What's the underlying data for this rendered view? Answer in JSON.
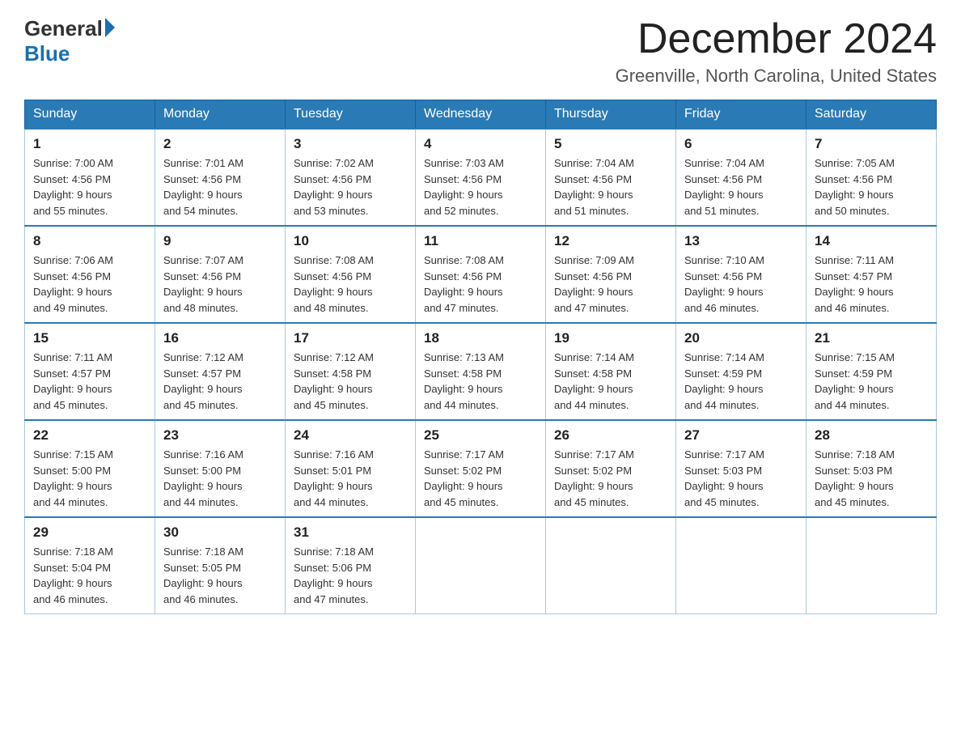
{
  "logo": {
    "general": "General",
    "blue": "Blue"
  },
  "header": {
    "month": "December 2024",
    "location": "Greenville, North Carolina, United States"
  },
  "days_of_week": [
    "Sunday",
    "Monday",
    "Tuesday",
    "Wednesday",
    "Thursday",
    "Friday",
    "Saturday"
  ],
  "weeks": [
    [
      {
        "day": "1",
        "sunrise": "7:00 AM",
        "sunset": "4:56 PM",
        "daylight": "9 hours and 55 minutes."
      },
      {
        "day": "2",
        "sunrise": "7:01 AM",
        "sunset": "4:56 PM",
        "daylight": "9 hours and 54 minutes."
      },
      {
        "day": "3",
        "sunrise": "7:02 AM",
        "sunset": "4:56 PM",
        "daylight": "9 hours and 53 minutes."
      },
      {
        "day": "4",
        "sunrise": "7:03 AM",
        "sunset": "4:56 PM",
        "daylight": "9 hours and 52 minutes."
      },
      {
        "day": "5",
        "sunrise": "7:04 AM",
        "sunset": "4:56 PM",
        "daylight": "9 hours and 51 minutes."
      },
      {
        "day": "6",
        "sunrise": "7:04 AM",
        "sunset": "4:56 PM",
        "daylight": "9 hours and 51 minutes."
      },
      {
        "day": "7",
        "sunrise": "7:05 AM",
        "sunset": "4:56 PM",
        "daylight": "9 hours and 50 minutes."
      }
    ],
    [
      {
        "day": "8",
        "sunrise": "7:06 AM",
        "sunset": "4:56 PM",
        "daylight": "9 hours and 49 minutes."
      },
      {
        "day": "9",
        "sunrise": "7:07 AM",
        "sunset": "4:56 PM",
        "daylight": "9 hours and 48 minutes."
      },
      {
        "day": "10",
        "sunrise": "7:08 AM",
        "sunset": "4:56 PM",
        "daylight": "9 hours and 48 minutes."
      },
      {
        "day": "11",
        "sunrise": "7:08 AM",
        "sunset": "4:56 PM",
        "daylight": "9 hours and 47 minutes."
      },
      {
        "day": "12",
        "sunrise": "7:09 AM",
        "sunset": "4:56 PM",
        "daylight": "9 hours and 47 minutes."
      },
      {
        "day": "13",
        "sunrise": "7:10 AM",
        "sunset": "4:56 PM",
        "daylight": "9 hours and 46 minutes."
      },
      {
        "day": "14",
        "sunrise": "7:11 AM",
        "sunset": "4:57 PM",
        "daylight": "9 hours and 46 minutes."
      }
    ],
    [
      {
        "day": "15",
        "sunrise": "7:11 AM",
        "sunset": "4:57 PM",
        "daylight": "9 hours and 45 minutes."
      },
      {
        "day": "16",
        "sunrise": "7:12 AM",
        "sunset": "4:57 PM",
        "daylight": "9 hours and 45 minutes."
      },
      {
        "day": "17",
        "sunrise": "7:12 AM",
        "sunset": "4:58 PM",
        "daylight": "9 hours and 45 minutes."
      },
      {
        "day": "18",
        "sunrise": "7:13 AM",
        "sunset": "4:58 PM",
        "daylight": "9 hours and 44 minutes."
      },
      {
        "day": "19",
        "sunrise": "7:14 AM",
        "sunset": "4:58 PM",
        "daylight": "9 hours and 44 minutes."
      },
      {
        "day": "20",
        "sunrise": "7:14 AM",
        "sunset": "4:59 PM",
        "daylight": "9 hours and 44 minutes."
      },
      {
        "day": "21",
        "sunrise": "7:15 AM",
        "sunset": "4:59 PM",
        "daylight": "9 hours and 44 minutes."
      }
    ],
    [
      {
        "day": "22",
        "sunrise": "7:15 AM",
        "sunset": "5:00 PM",
        "daylight": "9 hours and 44 minutes."
      },
      {
        "day": "23",
        "sunrise": "7:16 AM",
        "sunset": "5:00 PM",
        "daylight": "9 hours and 44 minutes."
      },
      {
        "day": "24",
        "sunrise": "7:16 AM",
        "sunset": "5:01 PM",
        "daylight": "9 hours and 44 minutes."
      },
      {
        "day": "25",
        "sunrise": "7:17 AM",
        "sunset": "5:02 PM",
        "daylight": "9 hours and 45 minutes."
      },
      {
        "day": "26",
        "sunrise": "7:17 AM",
        "sunset": "5:02 PM",
        "daylight": "9 hours and 45 minutes."
      },
      {
        "day": "27",
        "sunrise": "7:17 AM",
        "sunset": "5:03 PM",
        "daylight": "9 hours and 45 minutes."
      },
      {
        "day": "28",
        "sunrise": "7:18 AM",
        "sunset": "5:03 PM",
        "daylight": "9 hours and 45 minutes."
      }
    ],
    [
      {
        "day": "29",
        "sunrise": "7:18 AM",
        "sunset": "5:04 PM",
        "daylight": "9 hours and 46 minutes."
      },
      {
        "day": "30",
        "sunrise": "7:18 AM",
        "sunset": "5:05 PM",
        "daylight": "9 hours and 46 minutes."
      },
      {
        "day": "31",
        "sunrise": "7:18 AM",
        "sunset": "5:06 PM",
        "daylight": "9 hours and 47 minutes."
      },
      null,
      null,
      null,
      null
    ]
  ],
  "labels": {
    "sunrise": "Sunrise:",
    "sunset": "Sunset:",
    "daylight": "Daylight:"
  }
}
